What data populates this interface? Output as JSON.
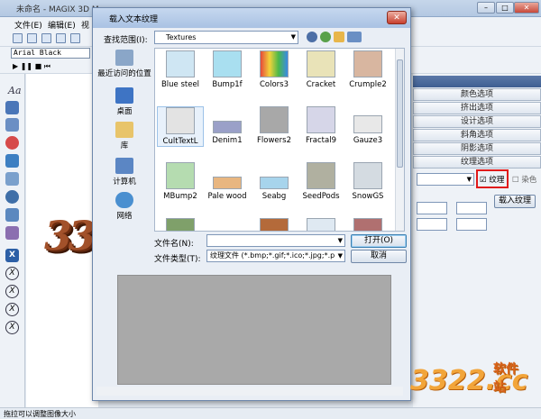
{
  "app": {
    "title": "未命名 - MAGIX 3D Ma...",
    "menu": [
      "文件(E)",
      "编辑(E)",
      "视"
    ],
    "font_name": "Arial Black",
    "status": "拖拉可以调整图像大小",
    "watermark_brand": "3322.cc",
    "watermark_sub": "软件站"
  },
  "right_panel": {
    "items": [
      "颜色选项",
      "挤出选项",
      "设计选项",
      "斜角选项",
      "阴影选项",
      "纹理选项"
    ],
    "texture_checkbox_label": "纹理",
    "dye_checkbox_label": "染色",
    "load_texture_button": "载入纹理"
  },
  "dialog": {
    "title": "载入文本纹理",
    "look_in_label": "查找范围(I):",
    "look_in_value": "Textures",
    "places": [
      "最近访问的位置",
      "桌面",
      "库",
      "计算机",
      "网络"
    ],
    "files": [
      {
        "name": "Blue steel",
        "color": "#cfe6f3"
      },
      {
        "name": "Bump1f",
        "color": "#a9dff0"
      },
      {
        "name": "Colors3",
        "color": "#e8b23a"
      },
      {
        "name": "Cracket",
        "color": "#e9e3b8"
      },
      {
        "name": "Crumple2",
        "color": "#d8b6a0"
      },
      {
        "name": "CultTextL",
        "color": "#e3e3e3"
      },
      {
        "name": "Denim1",
        "color": "#9aa0c8"
      },
      {
        "name": "Flowers2",
        "color": "#a8a8a8"
      },
      {
        "name": "Fractal9",
        "color": "#d6d6e8"
      },
      {
        "name": "Gauze3",
        "color": "#e8e8e8"
      },
      {
        "name": "MBump2",
        "color": "#b5dcb0"
      },
      {
        "name": "Pale wood",
        "color": "#e8b680"
      },
      {
        "name": "Seabg",
        "color": "#a7d4ec"
      },
      {
        "name": "SeedPods",
        "color": "#b0b0a0"
      },
      {
        "name": "SnowGS",
        "color": "#d4dbe1"
      }
    ],
    "file_name_label": "文件名(N):",
    "file_name_value": "",
    "file_type_label": "文件类型(T):",
    "file_type_value": "纹理文件 (*.bmp;*.gif;*.ico;*.jpg;*.p",
    "open_button": "打开(O)",
    "cancel_button": "取消"
  }
}
